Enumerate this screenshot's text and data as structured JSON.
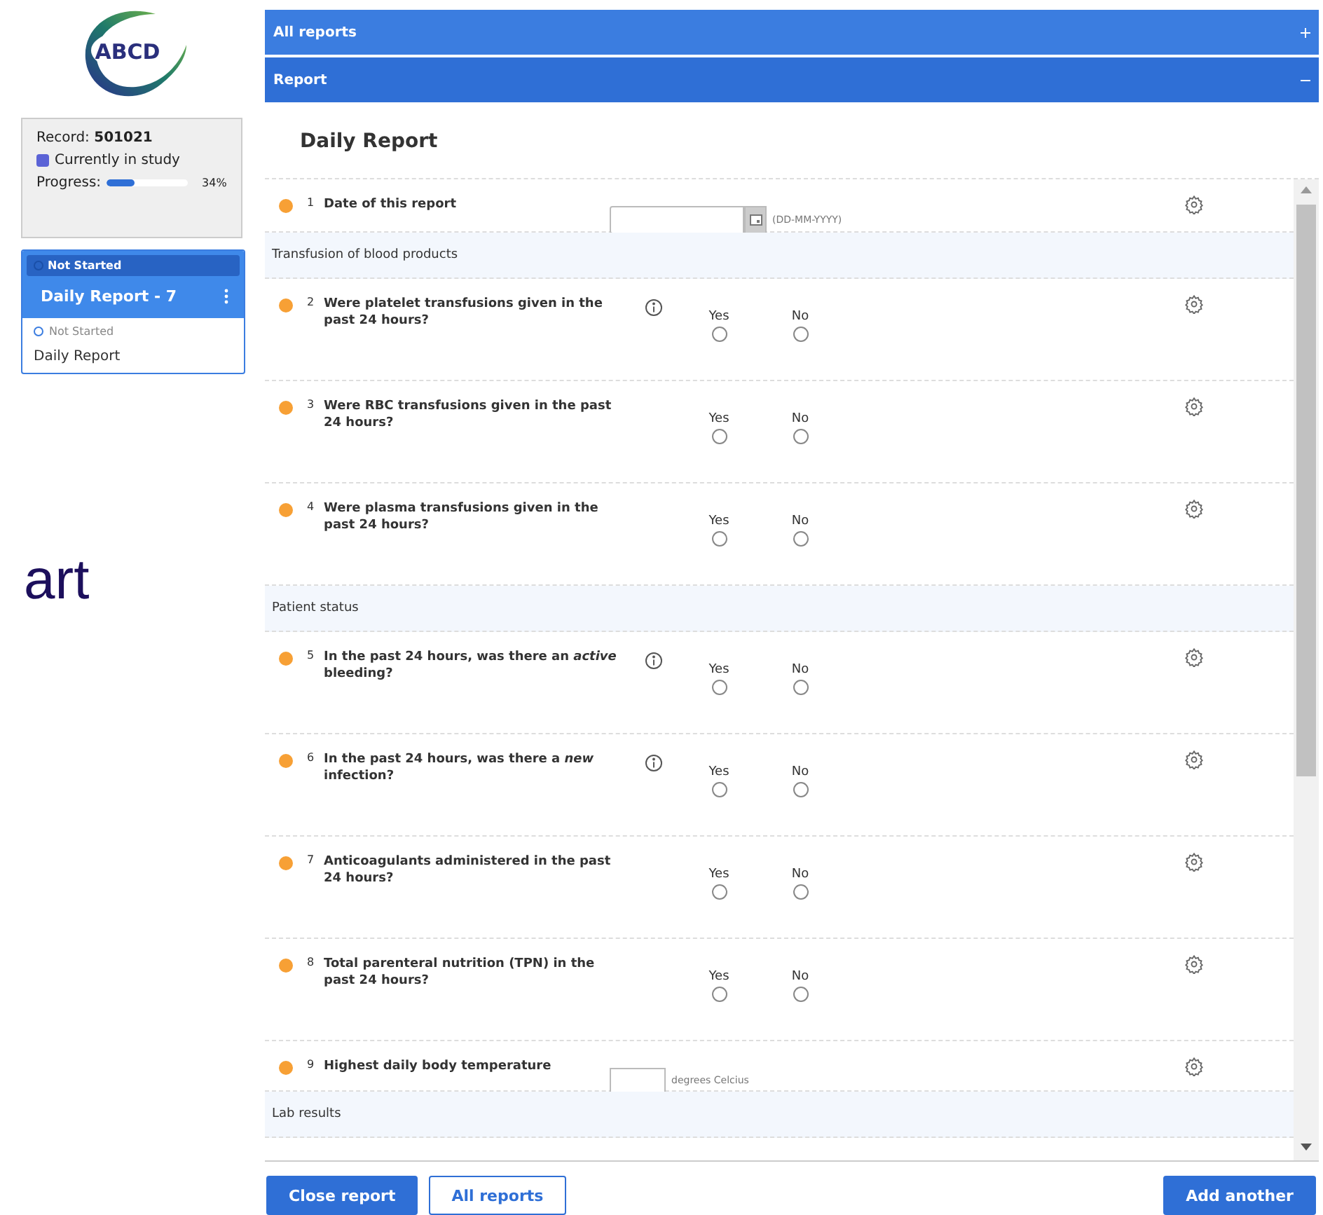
{
  "logo": {
    "text": "ABCD"
  },
  "record": {
    "label": "Record: **501021**",
    "status": {
      "label": "Currently in study",
      "color": "#5b63d6"
    },
    "progress": {
      "label": "Progress:",
      "level": 0.34,
      "reading": "34%"
    }
  },
  "report_card": {
    "badge": "Not Started",
    "title": "Daily Report - 7",
    "status": "Not Started",
    "name": "Daily Report"
  },
  "side_text": "art",
  "panels": [
    {
      "title": "All reports",
      "expanded": false
    },
    {
      "title": "Report",
      "expanded": true
    }
  ],
  "form": {
    "title": "Daily Report",
    "items": [
      {
        "kind": "date",
        "number": "1",
        "text": "Date of this report",
        "hint": "(DD-MM-YYYY)"
      },
      {
        "kind": "section",
        "text": "Transfusion of blood products"
      },
      {
        "kind": "yesno",
        "number": "2",
        "text": "Were platelet transfusions given in the past 24 hours?",
        "info": true,
        "options": [
          {
            "label": "Yes",
            "selected": false
          },
          {
            "label": "No",
            "selected": false
          }
        ]
      },
      {
        "kind": "yesno",
        "number": "3",
        "text": "Were RBC transfusions given in the past 24 hours?",
        "options": [
          {
            "label": "Yes",
            "selected": false
          },
          {
            "label": "No",
            "selected": false
          }
        ]
      },
      {
        "kind": "yesno",
        "number": "4",
        "text": "Were plasma transfusions given in the past 24 hours?",
        "options": [
          {
            "label": "Yes",
            "selected": false
          },
          {
            "label": "No",
            "selected": false
          }
        ]
      },
      {
        "kind": "section",
        "text": "Patient status"
      },
      {
        "kind": "yesno",
        "number": "5",
        "text": "In the past 24 hours, was there an *active* bleeding?",
        "info": true,
        "options": [
          {
            "label": "Yes",
            "selected": false
          },
          {
            "label": "No",
            "selected": false
          }
        ]
      },
      {
        "kind": "yesno",
        "number": "6",
        "text": "In the past 24 hours, was there a *new* infection?",
        "info": true,
        "options": [
          {
            "label": "Yes",
            "selected": false
          },
          {
            "label": "No",
            "selected": false
          }
        ]
      },
      {
        "kind": "yesno",
        "number": "7",
        "text": "Anticoagulants administered in the past 24 hours?",
        "options": [
          {
            "label": "Yes",
            "selected": false
          },
          {
            "label": "No",
            "selected": false
          }
        ]
      },
      {
        "kind": "yesno",
        "number": "8",
        "text": "Total parenteral nutrition (TPN) in the past 24 hours?",
        "options": [
          {
            "label": "Yes",
            "selected": false
          },
          {
            "label": "No",
            "selected": false
          }
        ]
      },
      {
        "kind": "number",
        "number": "9",
        "text": "Highest daily body temperature",
        "unit": "degrees Celcius"
      },
      {
        "kind": "section",
        "text": "Lab results"
      }
    ]
  },
  "buttons": [
    {
      "label": "Close report",
      "kind": "primary"
    },
    {
      "label": "All reports",
      "kind": "outline"
    },
    {
      "label": "Add another",
      "kind": "primary"
    }
  ]
}
